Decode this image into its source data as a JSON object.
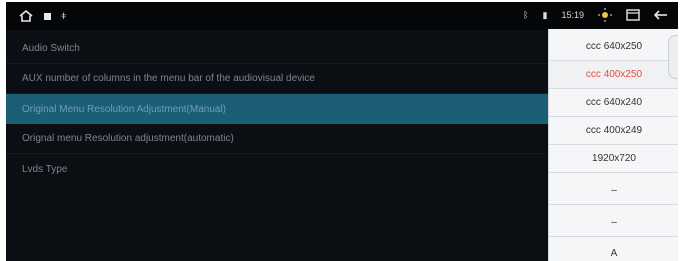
{
  "status_bar": {
    "time": "15:19",
    "left_icons": [
      "home-icon",
      "square-icon",
      "dot-icon"
    ],
    "right_icons": [
      "bluetooth-icon",
      "signal-icon",
      "brightness-icon",
      "window-icon",
      "back-icon"
    ]
  },
  "menu": {
    "items": [
      {
        "label": "Audio Switch"
      },
      {
        "label": "AUX number of columns in the menu bar of the audiovisual device"
      },
      {
        "label": "Original Menu Resolution Adjustment(Manual)"
      },
      {
        "label": "Orignal menu Resolution adjustment(automatic)"
      },
      {
        "label": "Lvds Type"
      }
    ],
    "active_index": 2
  },
  "dropdown": {
    "options": [
      {
        "label": "ccc 640x250"
      },
      {
        "label": "ccc 400x250"
      },
      {
        "label": "ccc 640x240"
      },
      {
        "label": "ccc 400x249"
      },
      {
        "label": "1920x720"
      },
      {
        "label": "–"
      },
      {
        "label": "–"
      },
      {
        "label": "A"
      }
    ],
    "selected_index": 1,
    "selected_color": "#e84a3b"
  },
  "colors": {
    "active_row": "#1c5e76",
    "background": "#0b0e12"
  }
}
